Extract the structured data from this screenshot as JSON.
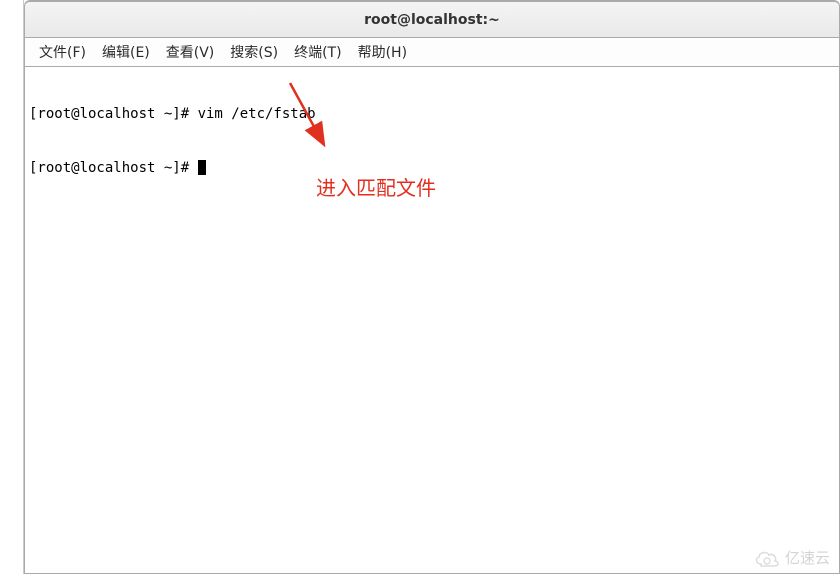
{
  "window": {
    "title": "root@localhost:~"
  },
  "menubar": {
    "items": [
      {
        "label": "文件(F)"
      },
      {
        "label": "编辑(E)"
      },
      {
        "label": "查看(V)"
      },
      {
        "label": "搜索(S)"
      },
      {
        "label": "终端(T)"
      },
      {
        "label": "帮助(H)"
      }
    ]
  },
  "terminal": {
    "lines": [
      {
        "prompt": "[root@localhost ~]# ",
        "cmd": "vim /etc/fstab"
      },
      {
        "prompt": "[root@localhost ~]# ",
        "cmd": ""
      }
    ]
  },
  "annotation": {
    "text": "进入匹配文件",
    "arrow_color": "#e03020"
  },
  "watermark": {
    "text": "亿速云"
  }
}
